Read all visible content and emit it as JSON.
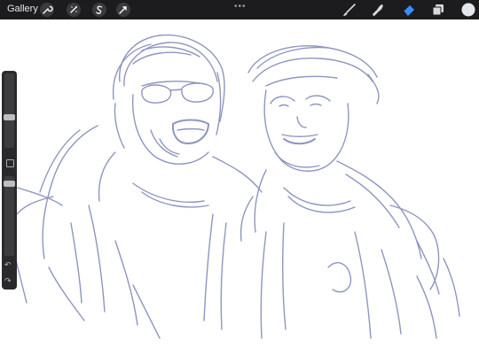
{
  "topbar": {
    "gallery_label": "Gallery",
    "left_tools": [
      "wrench-icon",
      "magic-wand-icon",
      "selection-icon",
      "transform-icon"
    ],
    "center": "more-icon",
    "right_tools": [
      "brush-icon",
      "smudge-icon",
      "eraser-icon",
      "layers-icon",
      "color-icon"
    ],
    "active_tool": "eraser-icon",
    "accent": "#3a8eff",
    "color_swatch": "#e4e6ee"
  },
  "sidebar": {
    "brush_size_level": 0.67,
    "opacity_level": 0.98,
    "undo_label": "↶",
    "redo_label": "↷"
  },
  "canvas": {
    "background": "#ffffff",
    "stroke_color": "#7a84b4"
  }
}
